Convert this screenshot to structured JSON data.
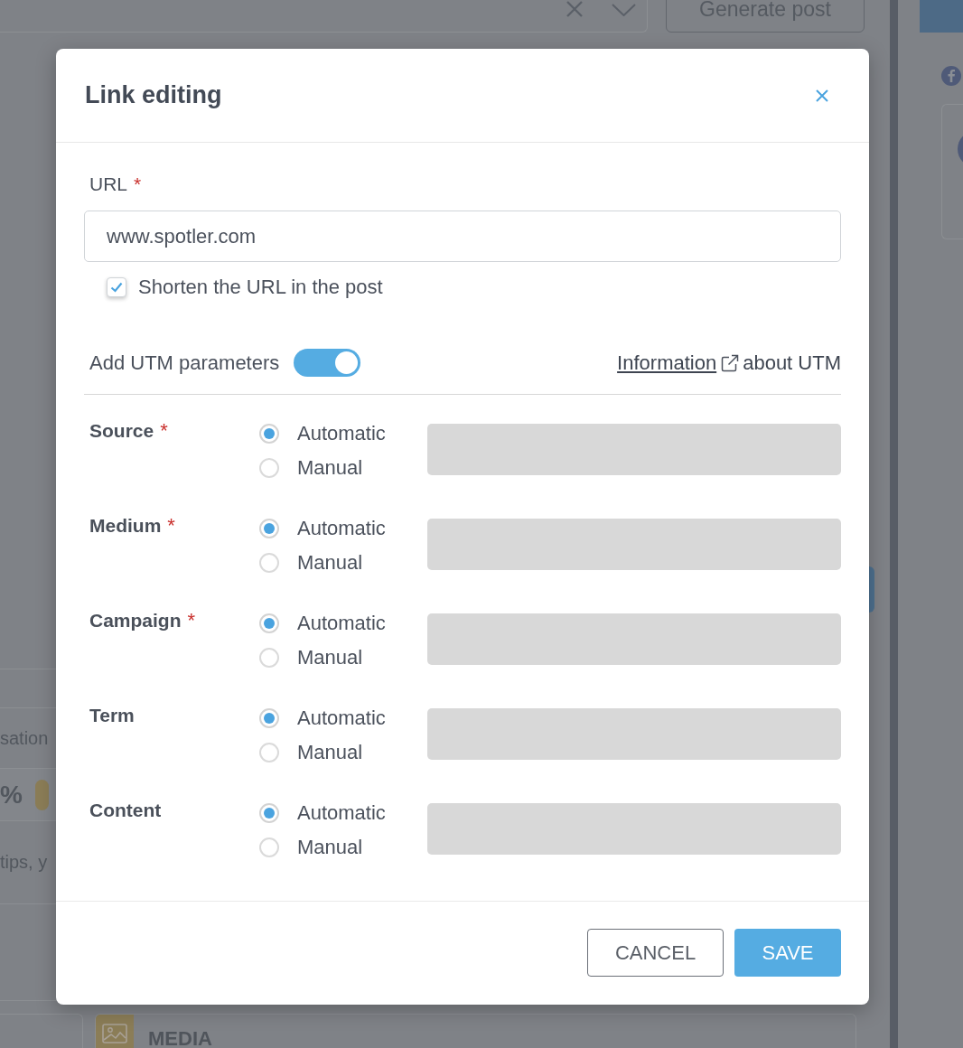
{
  "background": {
    "toolbar": {
      "button": "Generate post"
    },
    "side_list": {
      "rows": [
        {
          "kind": "text",
          "text": "sation"
        },
        {
          "kind": "metric",
          "text": "%"
        },
        {
          "kind": "text",
          "text": "tips, y"
        }
      ]
    },
    "sections": [
      {
        "title": "MEDIA"
      }
    ]
  },
  "dialog": {
    "title": "Link editing",
    "url": {
      "label": "URL",
      "required_mark": "*",
      "value": "www.spotler.com"
    },
    "shorten": {
      "label": "Shorten the URL in the post",
      "checked": true
    },
    "utm": {
      "label": "Add UTM parameters",
      "on": true,
      "link": "Information",
      "link_suffix": "about UTM"
    },
    "parameters": [
      {
        "label": "Source",
        "required_mark": "*",
        "options": [
          {
            "label": "Automatic",
            "selected": true
          },
          {
            "label": "Manual",
            "selected": false
          }
        ]
      },
      {
        "label": "Medium",
        "required_mark": "*",
        "options": [
          {
            "label": "Automatic",
            "selected": true
          },
          {
            "label": "Manual",
            "selected": false
          }
        ]
      },
      {
        "label": "Campaign",
        "required_mark": "*",
        "options": [
          {
            "label": "Automatic",
            "selected": true
          },
          {
            "label": "Manual",
            "selected": false
          }
        ]
      },
      {
        "label": "Term",
        "options": [
          {
            "label": "Automatic",
            "selected": true
          },
          {
            "label": "Manual",
            "selected": false
          }
        ]
      },
      {
        "label": "Content",
        "options": [
          {
            "label": "Automatic",
            "selected": true
          },
          {
            "label": "Manual",
            "selected": false
          }
        ]
      }
    ],
    "buttons": [
      {
        "kind": "secondary",
        "label": "CANCEL"
      },
      {
        "kind": "primary",
        "label": "SAVE"
      }
    ]
  }
}
